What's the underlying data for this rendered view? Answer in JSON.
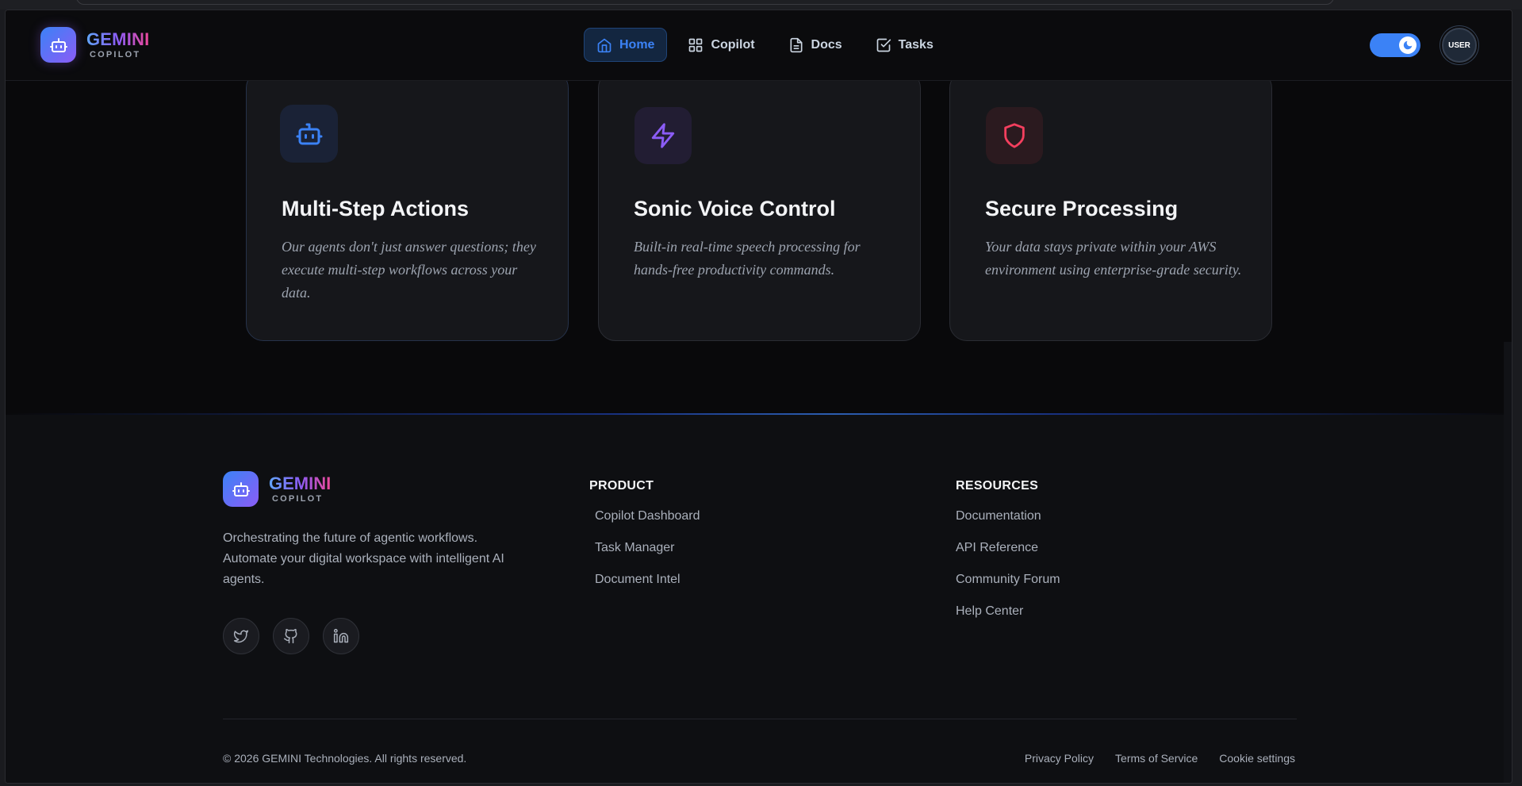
{
  "brand": {
    "name": "GEMINI",
    "sub": "COPILOT"
  },
  "nav": [
    {
      "label": "Home",
      "icon": "home-icon",
      "active": true
    },
    {
      "label": "Copilot",
      "icon": "grid-icon",
      "active": false
    },
    {
      "label": "Docs",
      "icon": "document-icon",
      "active": false
    },
    {
      "label": "Tasks",
      "icon": "checkbox-icon",
      "active": false
    }
  ],
  "user": {
    "avatar_label": "USER"
  },
  "features": [
    {
      "title": "Multi-Step Actions",
      "description": "Our agents don't just answer questions; they execute multi-step workflows across your data.",
      "icon": "robot-icon",
      "color": "#3b82f6"
    },
    {
      "title": "Sonic Voice Control",
      "description": "Built-in real-time speech processing for hands-free productivity commands.",
      "icon": "lightning-icon",
      "color": "#8b5cf6"
    },
    {
      "title": "Secure Processing",
      "description": "Your data stays private within your AWS environment using enterprise-grade security.",
      "icon": "shield-icon",
      "color": "#f43f5e"
    }
  ],
  "footer": {
    "tagline": "Orchestrating the future of agentic workflows. Automate your digital workspace with intelligent AI agents.",
    "socials": [
      "twitter-icon",
      "github-icon",
      "linkedin-icon"
    ],
    "product": {
      "heading": "PRODUCT",
      "links": [
        "Copilot Dashboard",
        "Task Manager",
        "Document Intel"
      ]
    },
    "resources": {
      "heading": "RESOURCES",
      "links": [
        "Documentation",
        "API Reference",
        "Community Forum",
        "Help Center"
      ]
    },
    "copyright": "© 2026 GEMINI Technologies. All rights reserved.",
    "legal": [
      "Privacy Policy",
      "Terms of Service",
      "Cookie settings"
    ]
  }
}
